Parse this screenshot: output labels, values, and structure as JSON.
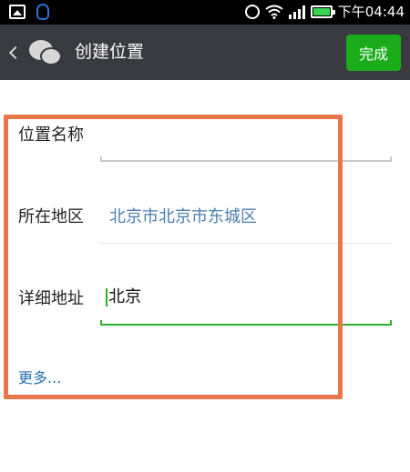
{
  "status_bar": {
    "time": "下午04:44",
    "icons": [
      "image-icon",
      "qq-icon",
      "alarm-icon",
      "wifi-icon",
      "signal-icon",
      "battery-icon"
    ]
  },
  "title_bar": {
    "title": "创建位置",
    "done_label": "完成",
    "icons": [
      "back-chevron-icon",
      "wechat-logo-icon"
    ]
  },
  "form": {
    "name": {
      "label": "位置名称",
      "value": ""
    },
    "region": {
      "label": "所在地区",
      "value": "北京市北京市东城区"
    },
    "address": {
      "label": "详细地址",
      "value": "北京"
    },
    "more_label": "更多..."
  },
  "colors": {
    "header_bg": "#393a3f",
    "done_button": "#1aad19",
    "region_text": "#4a7fb0",
    "active_underline": "#2bb02c",
    "annotation": "#e8764a",
    "link": "#2a6fb5"
  }
}
